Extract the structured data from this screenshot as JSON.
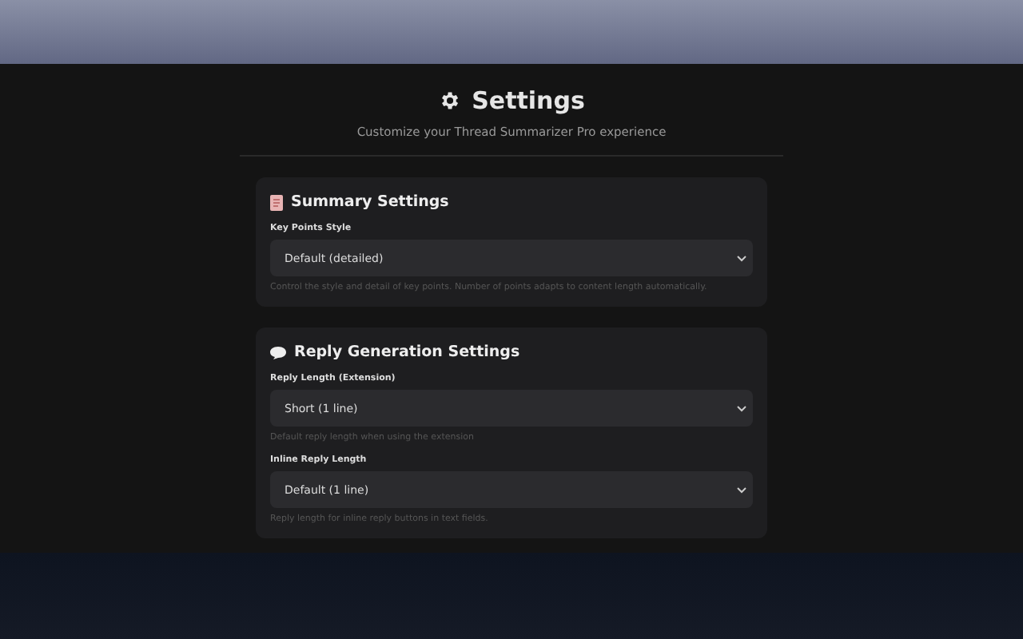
{
  "header": {
    "title": "Settings",
    "subtitle": "Customize your Thread Summarizer Pro experience"
  },
  "sections": [
    {
      "kind": "summary",
      "title": "Summary Settings",
      "fields": [
        {
          "label": "Key Points Style",
          "value": "Default (detailed)",
          "hint": "Control the style and detail of key points. Number of points adapts to content length automatically."
        }
      ]
    },
    {
      "kind": "reply",
      "title": "Reply Generation Settings",
      "fields": [
        {
          "label": "Reply Length (Extension)",
          "value": "Short (1 line)",
          "hint": "Default reply length when using the extension"
        },
        {
          "label": "Inline Reply Length",
          "value": "Default (1 line)",
          "hint": "Reply length for inline reply buttons in text fields."
        }
      ]
    }
  ]
}
